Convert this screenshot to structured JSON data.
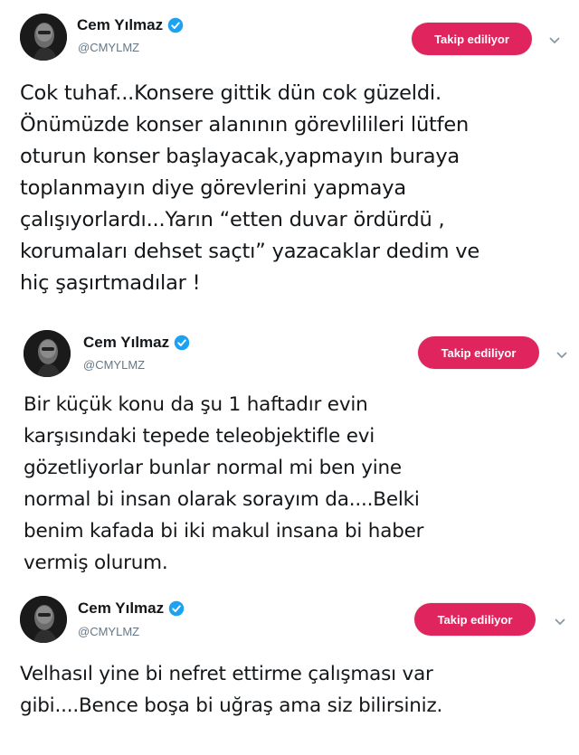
{
  "colors": {
    "follow_bg": "#e0245e",
    "verified": "#1da1f2",
    "handle": "#657786",
    "text": "#14171a"
  },
  "tweets": [
    {
      "author": {
        "name": "Cem Yılmaz",
        "handle": "@CMYLMZ",
        "verified_icon": "verified-badge-icon",
        "avatar_icon": "avatar"
      },
      "follow_label": "Takip ediliyor",
      "menu_icon": "chevron-down-icon",
      "text": "Cok tuhaf...Konsere gittik dün cok güzeldi.\nÖnümüzde konser alanının görevlilileri lütfen\noturun konser başlayacak,yapmayın buraya\ntoplanmayın diye görevlerini yapmaya\nçalışıyorlardı...Yarın “etten duvar ördürdü ,\nkorumaları dehset saçtı” yazacaklar dedim ve\nhiç şaşırtmadılar !"
    },
    {
      "author": {
        "name": "Cem Yılmaz",
        "handle": "@CMYLMZ",
        "verified_icon": "verified-badge-icon",
        "avatar_icon": "avatar"
      },
      "follow_label": "Takip ediliyor",
      "menu_icon": "chevron-down-icon",
      "text": "Bir küçük konu da şu 1 haftadır evin\nkarşısındaki tepede teleobjektifle evi\ngözetliyorlar bunlar normal mi ben yine\nnormal bi insan olarak sorayım da....Belki\nbenim kafada bi iki makul insana bi haber\nvermiş olurum."
    },
    {
      "author": {
        "name": "Cem Yılmaz",
        "handle": "@CMYLMZ",
        "verified_icon": "verified-badge-icon",
        "avatar_icon": "avatar"
      },
      "follow_label": "Takip ediliyor",
      "menu_icon": "chevron-down-icon",
      "text": "Velhasıl yine bi nefret ettirme çalışması var\ngibi....Bence boşa bi uğraş ama siz bilirsiniz."
    }
  ]
}
